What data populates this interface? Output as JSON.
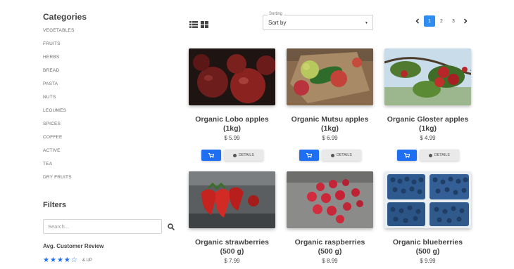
{
  "sidebar": {
    "categories_title": "Categories",
    "categories": [
      "VEGETABLES",
      "FRUITS",
      "HERBS",
      "BREAD",
      "PASTA",
      "NUTS",
      "LEGUMES",
      "SPICES",
      "COFFEE",
      "ACTIVE",
      "TEA",
      "DRY FRUITS"
    ],
    "filters_title": "Filters",
    "search_placeholder": "Search...",
    "review_title": "Avg. Customer Review",
    "rating": {
      "filled": 4,
      "total": 5,
      "suffix": "& UP"
    }
  },
  "toolbar": {
    "sorting_label": "Sorting",
    "sorting_value": "Sort by",
    "pages": [
      "1",
      "2",
      "3"
    ],
    "active_page": "1"
  },
  "products": [
    {
      "name": "Organic Lobo apples",
      "weight": "(1kg)",
      "price": "$ 5.99",
      "image": "red-apples"
    },
    {
      "name": "Organic Mutsu apples",
      "weight": "(1kg)",
      "price": "$ 6.99",
      "image": "green-red-apples-on-burlap"
    },
    {
      "name": "Organic Gloster apples",
      "weight": "(1kg)",
      "price": "$ 4.99",
      "image": "apples-on-tree"
    },
    {
      "name": "Organic strawberries",
      "weight": "(500 g)",
      "price": "$ 7.99",
      "image": "strawberries"
    },
    {
      "name": "Organic raspberries",
      "weight": "(500 g)",
      "price": "$ 8.99",
      "image": "raspberries"
    },
    {
      "name": "Organic blueberries",
      "weight": "(500 g)",
      "price": "$ 9.99",
      "image": "blueberries"
    }
  ],
  "buttons": {
    "details_label": "DETAILS"
  },
  "colors": {
    "accent": "#1e6ff1",
    "page_active": "#2f8cf0"
  }
}
